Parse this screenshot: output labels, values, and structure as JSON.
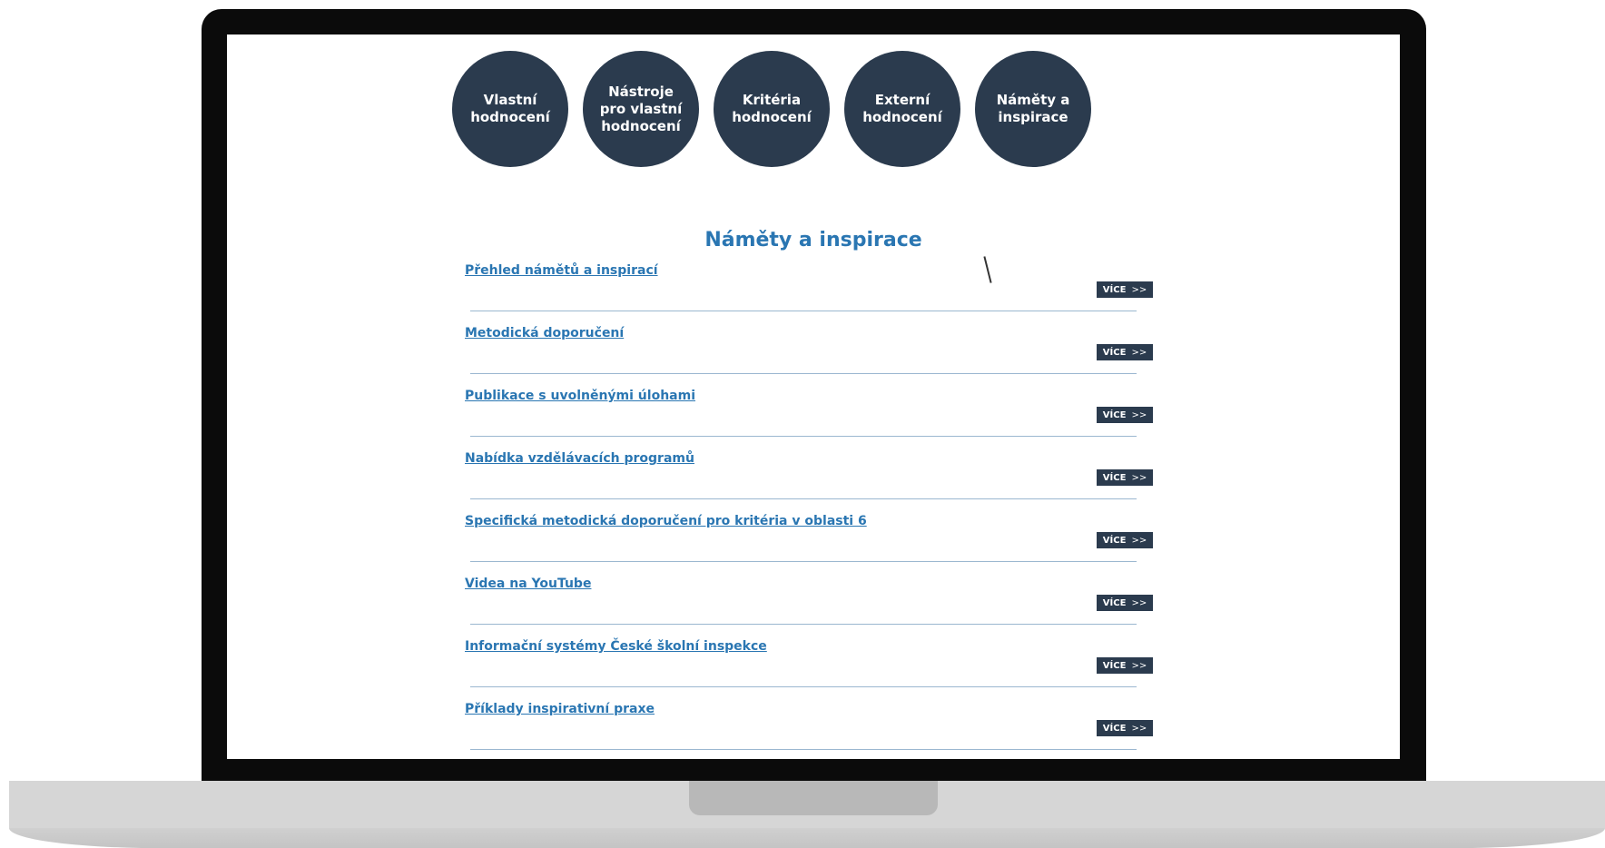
{
  "nav_circles": [
    {
      "label": "Vlastní hodnocení",
      "lines": [
        "Vlastní",
        "hodnocení"
      ]
    },
    {
      "label": "Nástroje pro vlastní hodnocení",
      "lines": [
        "Nástroje",
        "pro vlastní",
        "hodnocení"
      ]
    },
    {
      "label": "Kritéria hodnocení",
      "lines": [
        "Kritéria",
        "hodnocení"
      ]
    },
    {
      "label": "Externí hodnocení",
      "lines": [
        "Externí",
        "hodnocení"
      ]
    },
    {
      "label": "Náměty a inspirace",
      "lines": [
        "Náměty a",
        "inspirace"
      ]
    }
  ],
  "section": {
    "title": "Náměty a inspirace"
  },
  "items": [
    {
      "label": "Přehled námětů a inspirací",
      "more_label": "VÍCE",
      "more_arrow": ">>"
    },
    {
      "label": "Metodická doporučení",
      "more_label": "VÍCE",
      "more_arrow": ">>"
    },
    {
      "label": "Publikace s uvolněnými úlohami",
      "more_label": "VÍCE",
      "more_arrow": ">>"
    },
    {
      "label": "Nabídka vzdělávacích programů",
      "more_label": "VÍCE",
      "more_arrow": ">>"
    },
    {
      "label": "Specifická metodická doporučení pro kritéria v oblasti 6",
      "more_label": "VÍCE",
      "more_arrow": ">>"
    },
    {
      "label": "Videa na YouTube",
      "more_label": "VÍCE",
      "more_arrow": ">>"
    },
    {
      "label": "Informační systémy České školní inspekce",
      "more_label": "VÍCE",
      "more_arrow": ">>"
    },
    {
      "label": "Příklady inspirativní praxe",
      "more_label": "VÍCE",
      "more_arrow": ">>"
    }
  ],
  "colors": {
    "circle_bg": "#2b3b4e",
    "accent": "#2a76b2",
    "divider": "#9bb7d0",
    "button_bg": "#2b3b4e"
  }
}
